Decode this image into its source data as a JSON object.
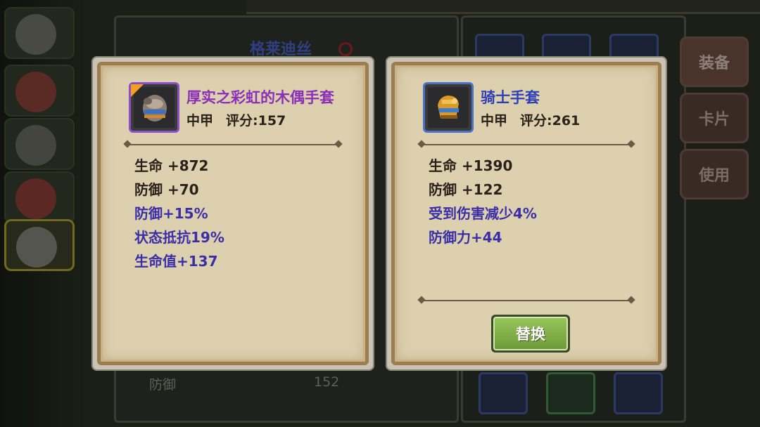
{
  "background": {
    "hero_name": "格莱迪丝",
    "stat_label": "防御",
    "stat_value": "152",
    "side_tabs": [
      "装备",
      "卡片",
      "使用"
    ]
  },
  "current_item": {
    "name": "厚实之彩虹的木偶手套",
    "type": "中甲",
    "score": "评分:157",
    "rarity_color": "#8a2fb8",
    "icon": "puppet-glove-icon",
    "base_stats": [
      "生命 +872",
      "防御 +70"
    ],
    "extra_stats": [
      "防御+15%",
      "状态抵抗19%",
      "生命值+137"
    ]
  },
  "new_item": {
    "name": "骑士手套",
    "type": "中甲",
    "score": "评分:261",
    "rarity_color": "#2f3fb8",
    "icon": "knight-glove-icon",
    "base_stats": [
      "生命 +1390",
      "防御 +122"
    ],
    "extra_stats": [
      "受到伤害减少4%",
      "防御力+44"
    ],
    "replace_label": "替换"
  }
}
